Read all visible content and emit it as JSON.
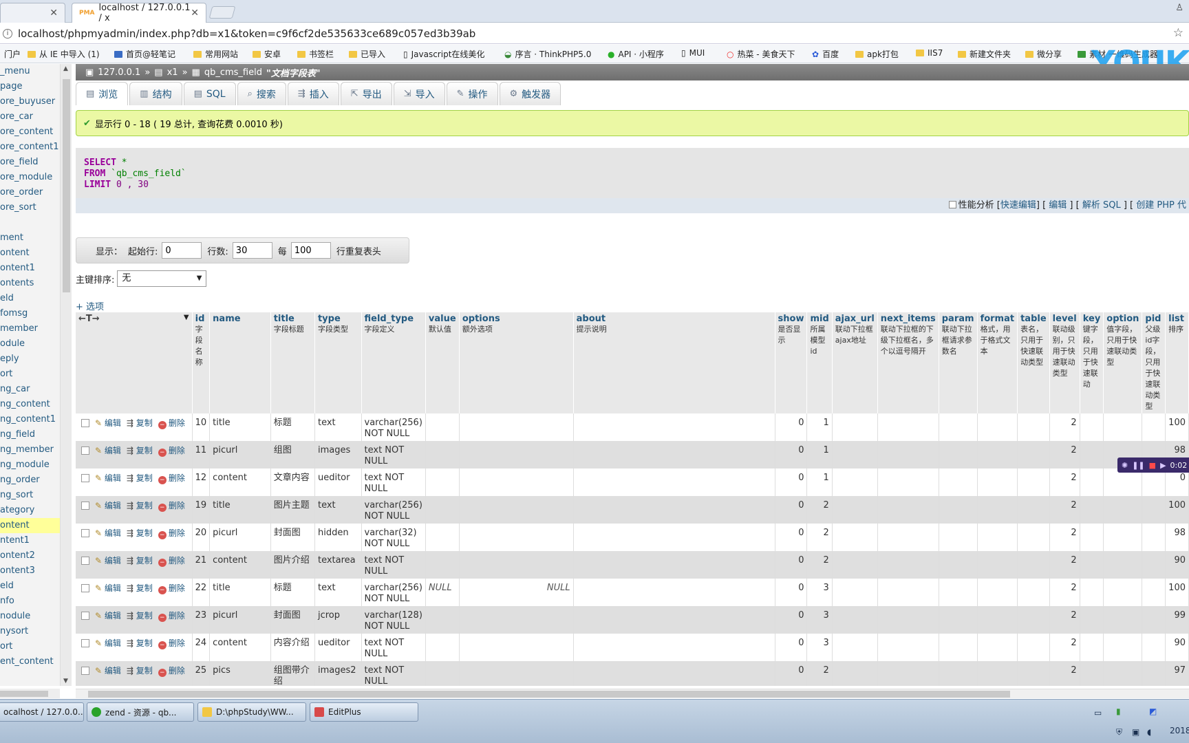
{
  "browser": {
    "tabs": [
      {
        "label": ""
      },
      {
        "label": "localhost / 127.0.0.1 / x"
      }
    ],
    "url": "localhost/phpmyadmin/index.php?db=x1&token=c9f6cf2de535633ce689c057ed3b39ab",
    "bookmarks": [
      "门户",
      "从 IE 中导入 (1)",
      "首页@轻笔记",
      "常用网站",
      "安卓",
      "书签栏",
      "已导入",
      "Javascript在线美化",
      "序言 · ThinkPHP5.0",
      "API · 小程序",
      "MUI",
      "热菜 - 美食天下",
      "百度",
      "apk打包",
      "IIS7",
      "新建文件夹",
      "微分享",
      "素材 一维码生成器"
    ],
    "watermark": "YOUK"
  },
  "sidebar": {
    "items": [
      "_menu",
      "page",
      "ore_buyuser",
      "ore_car",
      "ore_content",
      "ore_content1",
      "ore_field",
      "ore_module",
      "ore_order",
      "ore_sort",
      "",
      "ment",
      "ontent",
      "ontent1",
      "ontents",
      "eld",
      "fomsg",
      "member",
      "odule",
      "eply",
      "ort",
      "ng_car",
      "ng_content",
      "ng_content1",
      "ng_field",
      "ng_member",
      "ng_module",
      "ng_order",
      "ng_sort",
      "ategory",
      "ontent",
      "ntent1",
      "ontent2",
      "ontent3",
      "eld",
      "nfo",
      "nodule",
      "nysort",
      "ort",
      "ent_content"
    ]
  },
  "breadcrumb": {
    "server": "127.0.0.1",
    "sep": "»",
    "db": "x1",
    "table": "qb_cms_field",
    "comment": "\"文档字段表\""
  },
  "tabs": {
    "browse": "浏览",
    "structure": "结构",
    "sql": "SQL",
    "search": "搜索",
    "insert": "插入",
    "export": "导出",
    "import": "导入",
    "operations": "操作",
    "triggers": "触发器"
  },
  "message": "显示行 0 - 18 ( 19 总计, 查询花费 0.0010 秒)",
  "sql": {
    "select": "SELECT",
    "star": " *",
    "from": "FROM",
    "table": " `qb_cms_field`",
    "limit": "LIMIT",
    "limit_val": " 0 , 30"
  },
  "sql_options": {
    "profiling": "性能分析",
    "quick_edit": "快速编辑",
    "edit": "编辑",
    "explain": "解析 SQL",
    "php": "创建 PHP 代"
  },
  "display": {
    "label": "显示：",
    "start_label": "起始行:",
    "start": "0",
    "rows_label": "行数:",
    "rows": "30",
    "per_label": "每",
    "per": "100",
    "repeat_label": "行重复表头"
  },
  "sort": {
    "label": "主键排序:",
    "value": "无"
  },
  "options_link": "+ 选项",
  "table": {
    "arrows": "←T→",
    "columns": [
      {
        "name": "id",
        "comment": "字段名称"
      },
      {
        "name": "name",
        "comment": ""
      },
      {
        "name": "title",
        "comment": "字段标题"
      },
      {
        "name": "type",
        "comment": "字段类型"
      },
      {
        "name": "field_type",
        "comment": "字段定义"
      },
      {
        "name": "value",
        "comment": "默认值"
      },
      {
        "name": "options",
        "comment": "额外选项"
      },
      {
        "name": "about",
        "comment": "提示说明"
      },
      {
        "name": "show",
        "comment": "是否显示"
      },
      {
        "name": "mid",
        "comment": "所属模型id"
      },
      {
        "name": "ajax_url",
        "comment": "联动下拉框ajax地址"
      },
      {
        "name": "next_items",
        "comment": "联动下拉框的下级下拉框名，多个以逗号隔开"
      },
      {
        "name": "param",
        "comment": "联动下拉框请求参数名"
      },
      {
        "name": "format",
        "comment": "格式，用于格式文本"
      },
      {
        "name": "table",
        "comment": "表名，只用于快速联动类型"
      },
      {
        "name": "level",
        "comment": "联动级别，只用于快速联动类型"
      },
      {
        "name": "key",
        "comment": "键字段，只用于快速联动"
      },
      {
        "name": "option",
        "comment": "值字段，只用于快速联动类型"
      },
      {
        "name": "pid",
        "comment": "父级id字段，只用于快速联动类型"
      },
      {
        "name": "list",
        "comment": "排序"
      }
    ],
    "actions": {
      "edit": "编辑",
      "copy": "复制",
      "delete": "删除"
    },
    "rows": [
      {
        "id": "10",
        "name": "title",
        "title": "标题",
        "type": "text",
        "field_type": "varchar(256) NOT NULL",
        "value": "",
        "options": "",
        "show": "0",
        "mid": "1",
        "level": "2",
        "list": "100"
      },
      {
        "id": "11",
        "name": "picurl",
        "title": "组图",
        "type": "images",
        "field_type": "text NOT NULL",
        "value": "",
        "options": "",
        "show": "0",
        "mid": "1",
        "level": "2",
        "list": "98"
      },
      {
        "id": "12",
        "name": "content",
        "title": "文章内容",
        "type": "ueditor",
        "field_type": "text NOT NULL",
        "value": "",
        "options": "",
        "show": "0",
        "mid": "1",
        "level": "2",
        "list": "0"
      },
      {
        "id": "19",
        "name": "title",
        "title": "图片主题",
        "type": "text",
        "field_type": "varchar(256) NOT NULL",
        "value": "",
        "options": "",
        "show": "0",
        "mid": "2",
        "level": "2",
        "list": "100"
      },
      {
        "id": "20",
        "name": "picurl",
        "title": "封面图",
        "type": "hidden",
        "field_type": "varchar(32) NOT NULL",
        "value": "",
        "options": "",
        "show": "0",
        "mid": "2",
        "level": "2",
        "list": "98"
      },
      {
        "id": "21",
        "name": "content",
        "title": "图片介绍",
        "type": "textarea",
        "field_type": "text NOT NULL",
        "value": "",
        "options": "",
        "show": "0",
        "mid": "2",
        "level": "2",
        "list": "90"
      },
      {
        "id": "22",
        "name": "title",
        "title": "标题",
        "type": "text",
        "field_type": "varchar(256) NOT NULL",
        "value": "NULL",
        "options": "NULL",
        "show": "0",
        "mid": "3",
        "level": "2",
        "list": "100"
      },
      {
        "id": "23",
        "name": "picurl",
        "title": "封面图",
        "type": "jcrop",
        "field_type": "varchar(128) NOT NULL",
        "value": "",
        "options": "",
        "show": "0",
        "mid": "3",
        "level": "2",
        "list": "99"
      },
      {
        "id": "24",
        "name": "content",
        "title": "内容介绍",
        "type": "ueditor",
        "field_type": "text NOT NULL",
        "value": "",
        "options": "",
        "show": "0",
        "mid": "3",
        "level": "2",
        "list": "90"
      },
      {
        "id": "25",
        "name": "pics",
        "title": "组图带介绍",
        "type": "images2",
        "field_type": "text NOT NULL",
        "value": "",
        "options": "",
        "show": "0",
        "mid": "2",
        "level": "2",
        "list": "97"
      }
    ]
  },
  "video_overlay": {
    "time": "0:02"
  },
  "taskbar": {
    "items": [
      "ocalhost / 127.0.0....",
      "zend - 资源 - qb...",
      "D:\\phpStudy\\WW...",
      "EditPlus"
    ],
    "clock": "2018"
  }
}
